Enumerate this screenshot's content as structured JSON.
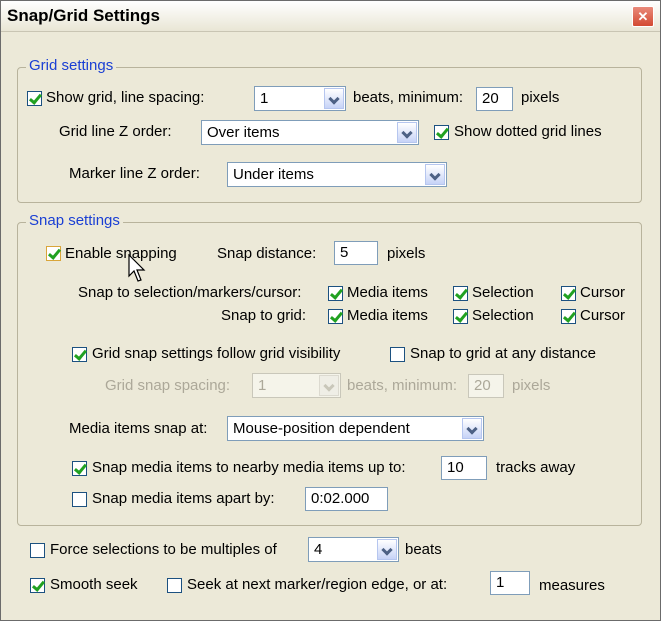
{
  "window": {
    "title": "Snap/Grid Settings",
    "close_glyph": "✕"
  },
  "grid": {
    "legend": "Grid settings",
    "show_grid_label": "Show grid, line spacing:",
    "line_spacing_value": "1",
    "beats_min_label": "beats, minimum:",
    "min_pixels_value": "20",
    "pixels_label": "pixels",
    "z_order_label": "Grid line Z order:",
    "z_order_value": "Over items",
    "show_dotted_label": "Show dotted grid lines",
    "marker_z_label": "Marker line  Z order:",
    "marker_z_value": "Under items"
  },
  "snap": {
    "legend": "Snap settings",
    "enable_label": "Enable snapping",
    "distance_label": "Snap distance:",
    "distance_value": "5",
    "distance_unit": "pixels",
    "to_selection_label": "Snap to selection/markers/cursor:",
    "to_grid_label": "Snap to grid:",
    "media_items_label": "Media items",
    "selection_label": "Selection",
    "cursor_label": "Cursor",
    "follow_visibility_label": "Grid snap settings follow grid visibility",
    "any_distance_label": "Snap to grid at any distance",
    "spacing_label": "Grid snap spacing:",
    "spacing_value": "1",
    "spacing_beats_label": "beats, minimum:",
    "spacing_min_value": "20",
    "spacing_pixels_label": "pixels",
    "media_snap_at_label": "Media items snap at:",
    "media_snap_at_value": "Mouse-position dependent",
    "nearby_label": "Snap media items to nearby media items up to:",
    "nearby_value": "10",
    "nearby_unit": "tracks away",
    "apart_label": "Snap media items apart by:",
    "apart_value": "0:02.000"
  },
  "bottom": {
    "force_label": "Force selections to be multiples of",
    "force_value": "4",
    "force_unit": "beats",
    "smooth_label": "Smooth seek",
    "seek_label": "Seek at next marker/region edge, or at:",
    "seek_value": "1",
    "seek_unit": "measures"
  }
}
